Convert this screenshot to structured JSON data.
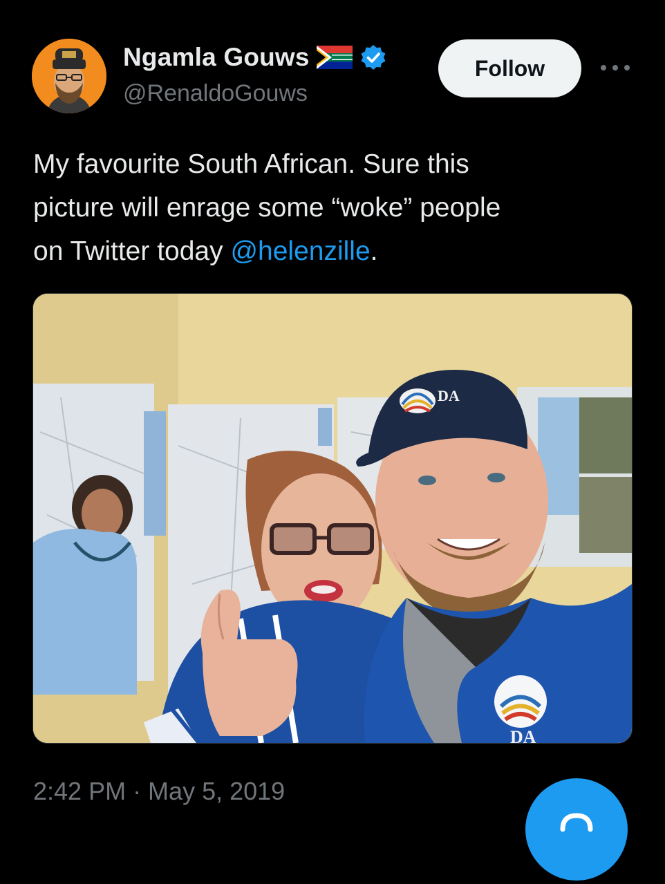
{
  "author": {
    "display_name": "Ngamla Gouws",
    "handle": "@RenaldoGouws",
    "flag_icon": "south-africa-flag-icon",
    "verified_icon": "verified-badge-icon"
  },
  "actions": {
    "follow_label": "Follow",
    "more_icon": "more-horizontal-icon"
  },
  "tweet": {
    "text_line_1": "My favourite South African. Sure this",
    "text_line_2": "picture will enrage some “woke” people",
    "text_line_3_prefix": "on Twitter today ",
    "mention": "@helenzille",
    "text_line_3_suffix": "."
  },
  "media": {
    "cap_logo_text": "DA",
    "jacket_logo_text": "DA"
  },
  "meta": {
    "timestamp": "2:42 PM · May 5, 2019"
  },
  "colors": {
    "background": "#000000",
    "text": "#e7e9ea",
    "secondary": "#71767b",
    "link": "#1d9bf0",
    "avatar_bg": "#f28c1e"
  },
  "compose_fab_icon": "compose-icon"
}
